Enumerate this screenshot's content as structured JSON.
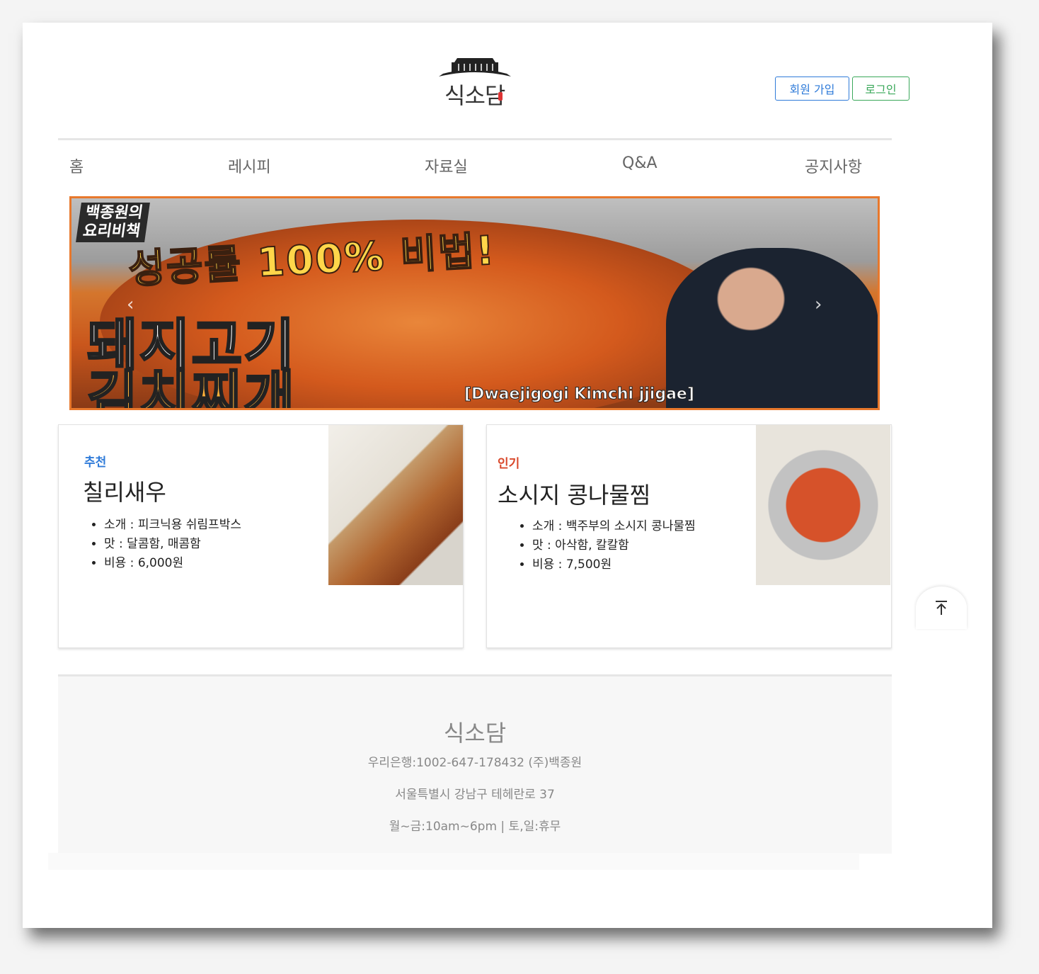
{
  "header": {
    "logo_text": "식소담",
    "signup_label": "회원 가입",
    "login_label": "로그인"
  },
  "nav": [
    {
      "label": "홈"
    },
    {
      "label": "레시피"
    },
    {
      "label": "자료실"
    },
    {
      "label": "Q&A"
    },
    {
      "label": "공지사항"
    }
  ],
  "banner": {
    "tag_line1": "백종원의",
    "tag_line2": "요리비책",
    "headline": "성공률 100% 비법!",
    "title_line1": "돼지고기",
    "title_line2": "김치찌개",
    "subtitle": "[Dwaejigogi Kimchi jjigae]"
  },
  "cards": [
    {
      "label": "추천",
      "label_color": "#2f7bd9",
      "title": "칠리새우",
      "items": [
        "소개 : 피크닉용 쉬림프박스",
        "맛 : 달콤함, 매콤함",
        "비용 : 6,000원"
      ]
    },
    {
      "label": "인기",
      "label_color": "#d9482b",
      "title": "소시지 콩나물찜",
      "items": [
        "소개 : 백주부의 소시지 콩나물찜",
        "맛 : 아삭함, 칼칼함",
        "비용 : 7,500원"
      ]
    }
  ],
  "footer": {
    "brand": "식소담",
    "bank": "우리은행:1002-647-178432 (주)백종원",
    "address": "서울특별시 강남구 테헤란로 37",
    "hours": "월~금:10am~6pm | 토,일:휴무"
  },
  "icons": {
    "scroll_top": "arrow-up-icon",
    "carousel_prev": "chevron-left-icon",
    "carousel_next": "chevron-right-icon"
  }
}
